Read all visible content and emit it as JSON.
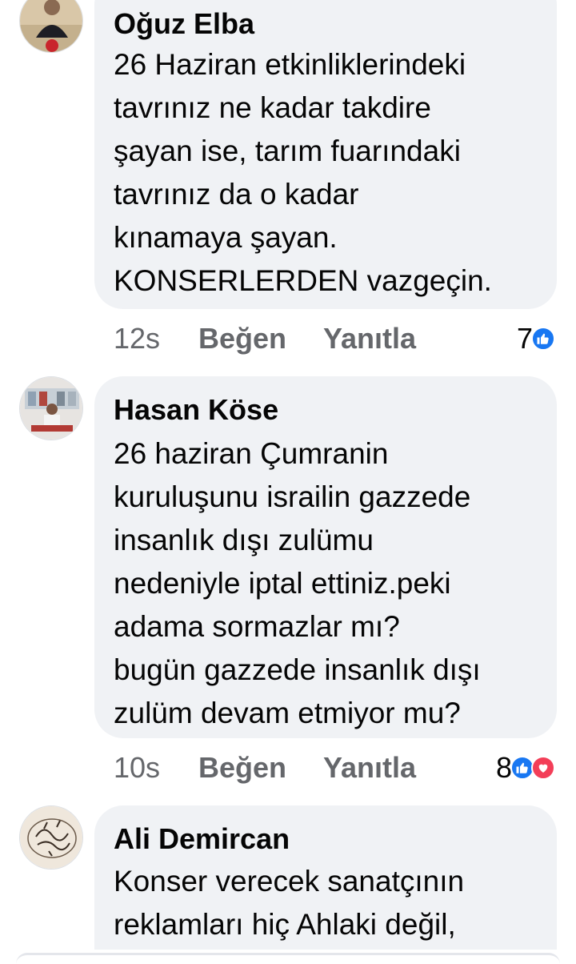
{
  "comments": [
    {
      "author": "Oğuz Elba",
      "lines": [
        "26 Haziran etkinliklerindeki",
        "tavrınız ne kadar takdire",
        "şayan ise, tarım fuarındaki",
        "tavrınız da o kadar",
        "kınamaya şayan.",
        "KONSERLERDEN vazgeçin."
      ],
      "time": "12s",
      "like_label": "Beğen",
      "reply_label": "Yanıtla",
      "reaction_count": "7",
      "reactions": [
        "like-icon"
      ]
    },
    {
      "author": "Hasan Köse",
      "lines": [
        "26 haziran Çumranin",
        "kuruluşunu israilin gazzede",
        "insanlık dışı zulümu",
        "nedeniyle iptal ettiniz.peki",
        "adama sormazlar mı?",
        "bugün gazzede insanlık dışı",
        "zulüm devam etmiyor mu?"
      ],
      "time": "10s",
      "like_label": "Beğen",
      "reply_label": "Yanıtla",
      "reaction_count": "8",
      "reactions": [
        "like-icon",
        "love-icon"
      ]
    },
    {
      "author": "Ali Demircan",
      "lines": [
        "Konser verecek sanatçının",
        "reklamları hiç Ahlaki değil,"
      ]
    }
  ],
  "colors": {
    "bubble": "#f0f2f5",
    "meta_text": "#65676b",
    "like_blue": "#1877f2",
    "love_red": "#f33e58"
  }
}
